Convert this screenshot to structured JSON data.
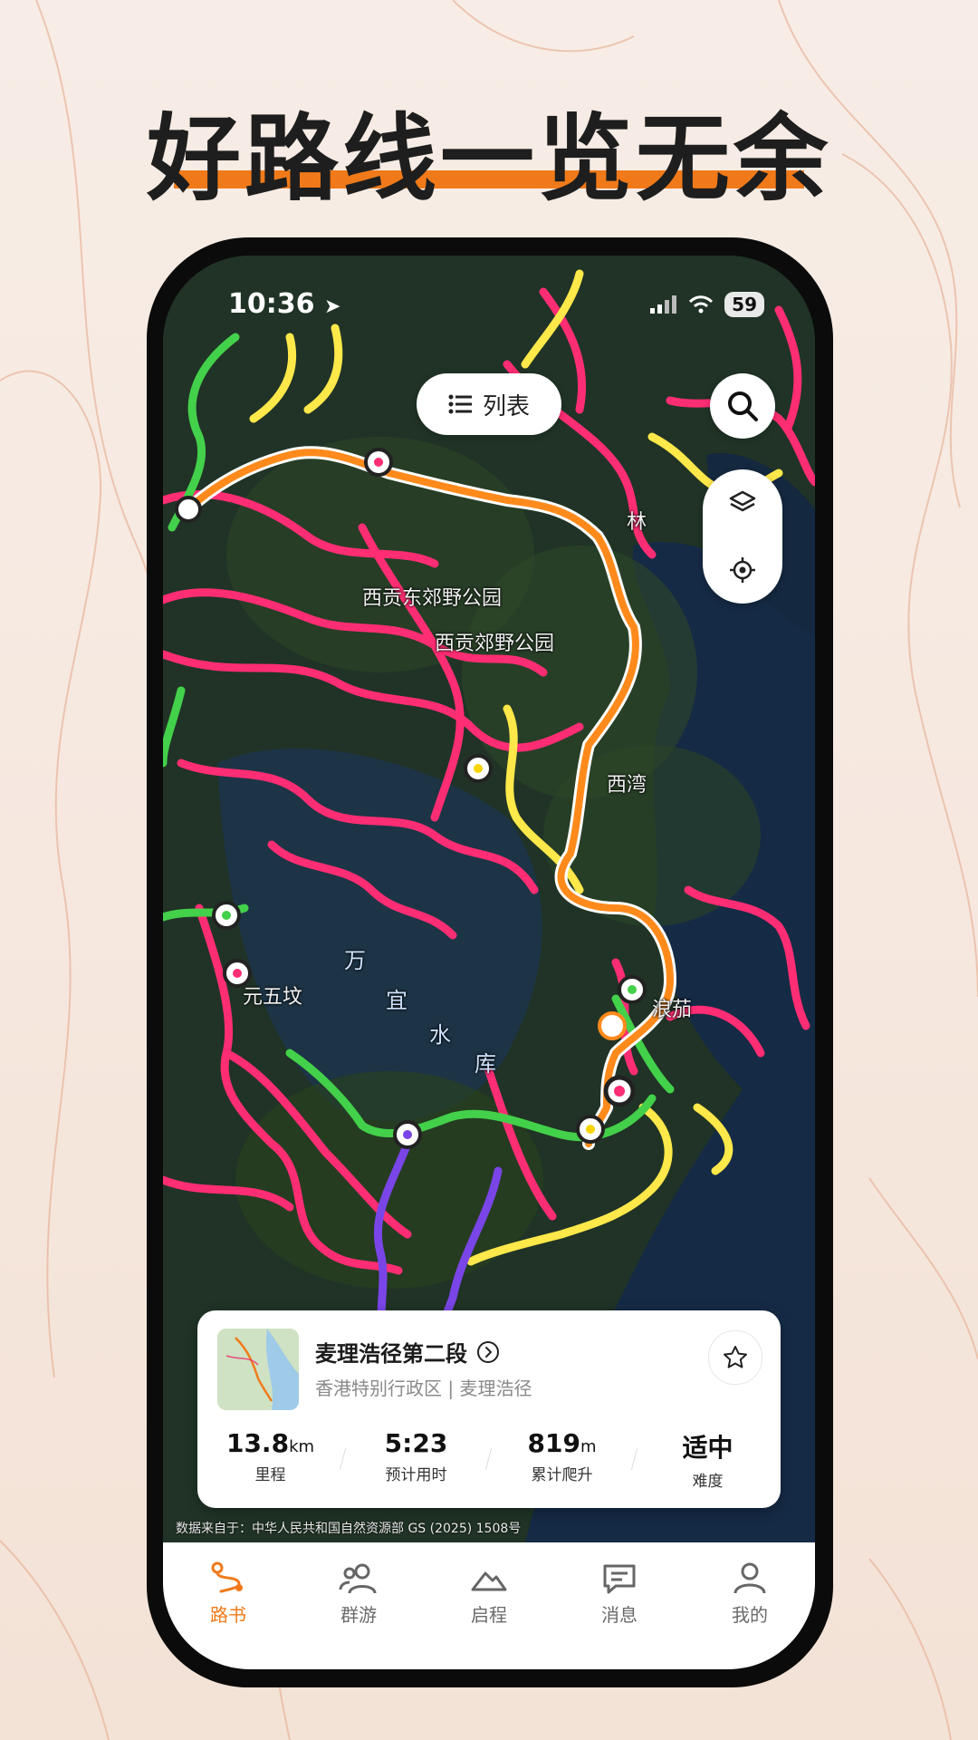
{
  "headline": "好路线一览无余",
  "status_bar": {
    "time": "10:36",
    "battery": "59"
  },
  "map": {
    "list_button_label": "列表",
    "labels": {
      "park1": "西贡东郊野公园",
      "park2": "西贡郊野公园",
      "town": "林",
      "bay1": "西湾",
      "bay2": "浪茄",
      "reservoir_chars": [
        "万",
        "宜",
        "水",
        "库"
      ],
      "place": "元五坟"
    },
    "credit": "数据来自于：中华人民共和国自然资源部 GS (2025) 1508号"
  },
  "route_card": {
    "title": "麦理浩径第二段",
    "subtitle": "香港特别行政区 | 麦理浩径",
    "stats": [
      {
        "value": "13.8",
        "unit": "km",
        "label": "里程"
      },
      {
        "value": "5:23",
        "unit": "",
        "label": "预计用时"
      },
      {
        "value": "819",
        "unit": "m",
        "label": "累计爬升"
      },
      {
        "value": "适中",
        "unit": "",
        "label": "难度"
      }
    ]
  },
  "tabbar": {
    "items": [
      {
        "label": "路书",
        "icon": "route-icon",
        "active": true
      },
      {
        "label": "群游",
        "icon": "group-icon",
        "active": false
      },
      {
        "label": "启程",
        "icon": "mountain-icon",
        "active": false
      },
      {
        "label": "消息",
        "icon": "message-icon",
        "active": false
      },
      {
        "label": "我的",
        "icon": "profile-icon",
        "active": false
      }
    ]
  },
  "colors": {
    "accent": "#f07a1a",
    "route_highlight": "#ff8a1c",
    "trail_pink": "#ff2d73",
    "trail_yellow": "#ffe84a",
    "trail_green": "#43d04a",
    "trail_purple": "#7a45e6"
  }
}
